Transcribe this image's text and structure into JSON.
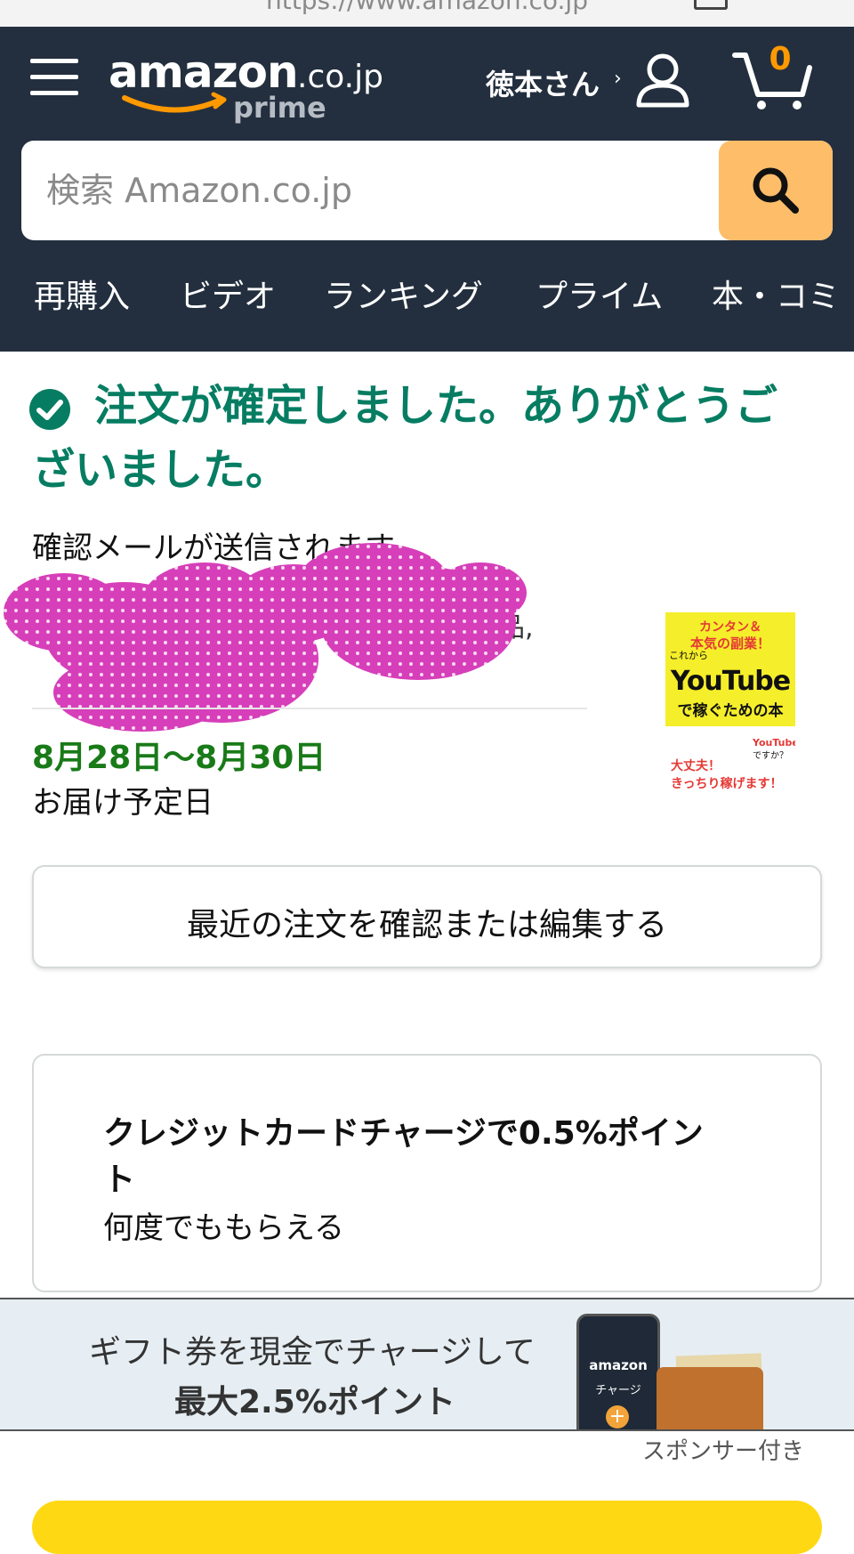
{
  "browser": {
    "url": "https://www.amazon.co.jp"
  },
  "header": {
    "logo_main": "amazon",
    "logo_tld": ".co.jp",
    "logo_sub": "prime",
    "account_label": "徳本さん",
    "account_chevron": "›",
    "cart_count": "0",
    "search_placeholder": "検索 Amazon.co.jp",
    "nav": [
      "再購入",
      "ビデオ",
      "ランキング",
      "プライム",
      "本・コミ"
    ]
  },
  "confirmation": {
    "title": "注文が確定しました。ありがとうございました。",
    "email_note": "確認メールが送信されます",
    "hidden_fragment": "品,",
    "delivery_date": "8月28日〜8月30日",
    "delivery_label": "お届け予定日"
  },
  "book": {
    "line1": "カンタン＆",
    "line2": "本気の副業！",
    "line3": "YouTube",
    "line4": "で稼ぐための本",
    "line5": "大丈夫！",
    "line6": "きっちり稼げます！",
    "small_top": "これから",
    "badge": "YouTube",
    "badge_sub": "ですか？"
  },
  "actions": {
    "recent_orders": "最近の注文を確認または編集する"
  },
  "promo": {
    "title": "クレジットカードチャージで0.5%ポイント",
    "subtitle": "何度でももらえる"
  },
  "banner": {
    "line1": "ギフト券を現金でチャージして",
    "line2": "最大2.5%ポイント",
    "phone_brand": "amazon",
    "phone_charge": "チャージ",
    "plus": "+"
  },
  "sponsored_label": "スポンサー付き",
  "colors": {
    "header_bg": "#232f3e",
    "accent": "#febd69",
    "success": "#067d62",
    "delivery": "#197a18"
  }
}
